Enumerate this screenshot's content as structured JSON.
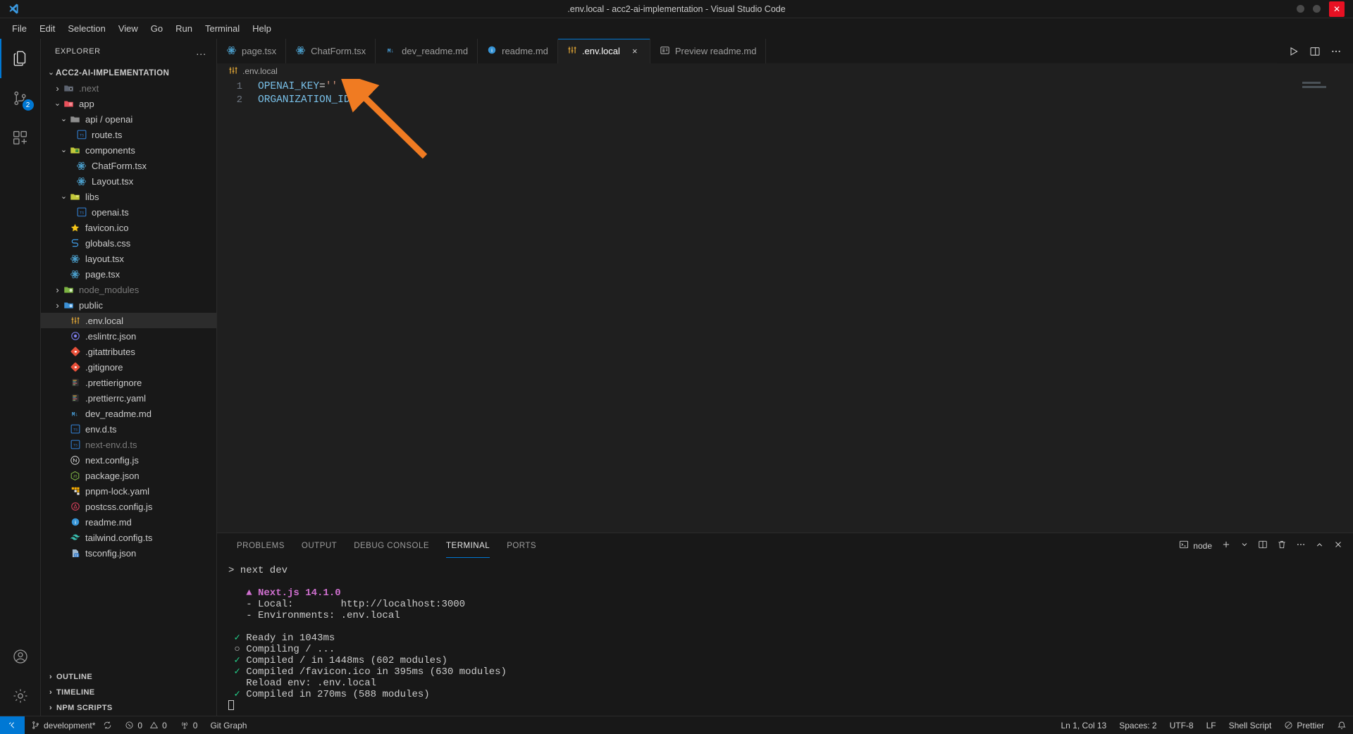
{
  "titlebar": {
    "title": ".env.local - acc2-ai-implementation - Visual Studio Code",
    "logo_icon": "vscode-logo-icon",
    "minimize_icon": "minimize-icon",
    "maximize_icon": "maximize-icon",
    "close_icon": "close-icon"
  },
  "menubar": {
    "items": [
      {
        "label": "File"
      },
      {
        "label": "Edit"
      },
      {
        "label": "Selection"
      },
      {
        "label": "View"
      },
      {
        "label": "Go"
      },
      {
        "label": "Run"
      },
      {
        "label": "Terminal"
      },
      {
        "label": "Help"
      }
    ]
  },
  "activitybar": {
    "items": [
      {
        "name": "explorer",
        "icon": "files-icon",
        "active": true,
        "badge": ""
      },
      {
        "name": "source-control",
        "icon": "source-control-icon",
        "active": false,
        "badge": "2"
      },
      {
        "name": "extensions",
        "icon": "extensions-icon",
        "active": false,
        "badge": ""
      }
    ],
    "bottom": [
      {
        "name": "accounts",
        "icon": "account-icon"
      },
      {
        "name": "settings",
        "icon": "gear-icon"
      }
    ]
  },
  "sidebar": {
    "title": "EXPLORER",
    "more_actions": "...",
    "root": "ACC2-AI-IMPLEMENTATION",
    "tree": [
      {
        "label": "ACC2-AI-IMPLEMENTATION",
        "indent": 0,
        "chevron": "down",
        "icon": "",
        "kind": "root"
      },
      {
        "label": ".next",
        "indent": 1,
        "chevron": "right",
        "icon": "folder-next",
        "kind": "folder",
        "dim": true
      },
      {
        "label": "app",
        "indent": 1,
        "chevron": "down",
        "icon": "folder-app",
        "kind": "folder"
      },
      {
        "label": "api / openai",
        "indent": 2,
        "chevron": "down",
        "icon": "folder-plain",
        "kind": "folder"
      },
      {
        "label": "route.ts",
        "indent": 3,
        "chevron": "none",
        "icon": "ts-icon",
        "kind": "file"
      },
      {
        "label": "components",
        "indent": 2,
        "chevron": "down",
        "icon": "folder-components",
        "kind": "folder"
      },
      {
        "label": "ChatForm.tsx",
        "indent": 3,
        "chevron": "none",
        "icon": "react-icon",
        "kind": "file"
      },
      {
        "label": "Layout.tsx",
        "indent": 3,
        "chevron": "none",
        "icon": "react-icon",
        "kind": "file"
      },
      {
        "label": "libs",
        "indent": 2,
        "chevron": "down",
        "icon": "folder-libs",
        "kind": "folder"
      },
      {
        "label": "openai.ts",
        "indent": 3,
        "chevron": "none",
        "icon": "ts-icon",
        "kind": "file"
      },
      {
        "label": "favicon.ico",
        "indent": 2,
        "chevron": "none",
        "icon": "star-icon",
        "kind": "file"
      },
      {
        "label": "globals.css",
        "indent": 2,
        "chevron": "none",
        "icon": "css-icon",
        "kind": "file"
      },
      {
        "label": "layout.tsx",
        "indent": 2,
        "chevron": "none",
        "icon": "react-icon",
        "kind": "file"
      },
      {
        "label": "page.tsx",
        "indent": 2,
        "chevron": "none",
        "icon": "react-icon",
        "kind": "file"
      },
      {
        "label": "node_modules",
        "indent": 1,
        "chevron": "right",
        "icon": "folder-node",
        "kind": "folder",
        "dim": true
      },
      {
        "label": "public",
        "indent": 1,
        "chevron": "right",
        "icon": "folder-public",
        "kind": "folder"
      },
      {
        "label": ".env.local",
        "indent": 2,
        "chevron": "none",
        "icon": "env-icon",
        "kind": "file",
        "selected": true
      },
      {
        "label": ".eslintrc.json",
        "indent": 2,
        "chevron": "none",
        "icon": "eslint-icon",
        "kind": "file"
      },
      {
        "label": ".gitattributes",
        "indent": 2,
        "chevron": "none",
        "icon": "git-icon",
        "kind": "file"
      },
      {
        "label": ".gitignore",
        "indent": 2,
        "chevron": "none",
        "icon": "git-icon",
        "kind": "file"
      },
      {
        "label": ".prettierignore",
        "indent": 2,
        "chevron": "none",
        "icon": "prettier-icon",
        "kind": "file"
      },
      {
        "label": ".prettierrc.yaml",
        "indent": 2,
        "chevron": "none",
        "icon": "prettier-icon",
        "kind": "file"
      },
      {
        "label": "dev_readme.md",
        "indent": 2,
        "chevron": "none",
        "icon": "markdown-icon",
        "kind": "file"
      },
      {
        "label": "env.d.ts",
        "indent": 2,
        "chevron": "none",
        "icon": "ts-icon",
        "kind": "file"
      },
      {
        "label": "next-env.d.ts",
        "indent": 2,
        "chevron": "none",
        "icon": "ts-icon",
        "kind": "file",
        "dim": true
      },
      {
        "label": "next.config.js",
        "indent": 2,
        "chevron": "none",
        "icon": "next-icon",
        "kind": "file"
      },
      {
        "label": "package.json",
        "indent": 2,
        "chevron": "none",
        "icon": "npm-icon",
        "kind": "file"
      },
      {
        "label": "pnpm-lock.yaml",
        "indent": 2,
        "chevron": "none",
        "icon": "pnpm-icon",
        "kind": "file"
      },
      {
        "label": "postcss.config.js",
        "indent": 2,
        "chevron": "none",
        "icon": "postcss-icon",
        "kind": "file"
      },
      {
        "label": "readme.md",
        "indent": 2,
        "chevron": "none",
        "icon": "info-icon",
        "kind": "file"
      },
      {
        "label": "tailwind.config.ts",
        "indent": 2,
        "chevron": "none",
        "icon": "tailwind-icon",
        "kind": "file"
      },
      {
        "label": "tsconfig.json",
        "indent": 2,
        "chevron": "none",
        "icon": "tsconfig-icon",
        "kind": "file"
      }
    ],
    "sections": [
      {
        "label": "OUTLINE",
        "chevron": "right"
      },
      {
        "label": "TIMELINE",
        "chevron": "right"
      },
      {
        "label": "NPM SCRIPTS",
        "chevron": "right"
      }
    ]
  },
  "editor": {
    "tabs": [
      {
        "label": "page.tsx",
        "icon": "react-icon",
        "active": false,
        "closable": false
      },
      {
        "label": "ChatForm.tsx",
        "icon": "react-icon",
        "active": false,
        "closable": false
      },
      {
        "label": "dev_readme.md",
        "icon": "markdown-icon",
        "active": false,
        "closable": false
      },
      {
        "label": "readme.md",
        "icon": "info-icon",
        "active": false,
        "closable": false
      },
      {
        "label": ".env.local",
        "icon": "env-icon",
        "active": true,
        "closable": true,
        "close_label": "×"
      },
      {
        "label": "Preview readme.md",
        "icon": "preview-icon",
        "active": false,
        "closable": false
      }
    ],
    "actions": [
      {
        "name": "run-button",
        "icon": "play-icon"
      },
      {
        "name": "split-editor-button",
        "icon": "split-editor-icon"
      },
      {
        "name": "more-actions-button",
        "icon": "ellipsis-icon"
      }
    ],
    "breadcrumb": {
      "icon": "env-icon",
      "label": ".env.local"
    },
    "lines": [
      {
        "number": "1",
        "tokens": [
          {
            "text": "OPENAI_KEY",
            "type": "var"
          },
          {
            "text": "=",
            "type": "op"
          },
          {
            "text": "''",
            "type": "str"
          }
        ]
      },
      {
        "number": "2",
        "tokens": [
          {
            "text": "ORGANIZATION_ID",
            "type": "var"
          },
          {
            "text": "=",
            "type": "op"
          },
          {
            "text": "''",
            "type": "str"
          }
        ]
      }
    ],
    "annotation": {
      "name": "orange-arrow-annotation",
      "color": "#f07b22"
    }
  },
  "panel": {
    "tabs": [
      {
        "label": "PROBLEMS",
        "active": false
      },
      {
        "label": "OUTPUT",
        "active": false
      },
      {
        "label": "DEBUG CONSOLE",
        "active": false
      },
      {
        "label": "TERMINAL",
        "active": true
      },
      {
        "label": "PORTS",
        "active": false
      }
    ],
    "terminal_chip": {
      "icon": "terminal-icon",
      "label": "node"
    },
    "actions": [
      {
        "name": "new-terminal-button",
        "icon": "plus-icon"
      },
      {
        "name": "terminal-dropdown-button",
        "icon": "chevron-down-icon"
      },
      {
        "name": "split-terminal-button",
        "icon": "split-icon"
      },
      {
        "name": "kill-terminal-button",
        "icon": "trash-icon"
      },
      {
        "name": "panel-more-button",
        "icon": "ellipsis-icon"
      },
      {
        "name": "maximize-panel-button",
        "icon": "chevron-up-icon"
      },
      {
        "name": "close-panel-button",
        "icon": "close-icon"
      }
    ],
    "terminal_lines": [
      {
        "segments": [
          {
            "text": "> next dev",
            "color": "grey"
          }
        ]
      },
      {
        "segments": [
          {
            "text": "",
            "color": "grey"
          }
        ]
      },
      {
        "segments": [
          {
            "text": "   ▲ Next.js 14.1.0",
            "color": "pink"
          }
        ]
      },
      {
        "segments": [
          {
            "text": "   - Local:        http://localhost:3000",
            "color": "grey"
          }
        ]
      },
      {
        "segments": [
          {
            "text": "   - Environments: .env.local",
            "color": "grey"
          }
        ]
      },
      {
        "segments": [
          {
            "text": "",
            "color": "grey"
          }
        ]
      },
      {
        "segments": [
          {
            "text": " ✓ ",
            "color": "green"
          },
          {
            "text": "Ready in 1043ms",
            "color": "grey"
          }
        ]
      },
      {
        "segments": [
          {
            "text": " ○ ",
            "color": "grey"
          },
          {
            "text": "Compiling / ...",
            "color": "grey"
          }
        ]
      },
      {
        "segments": [
          {
            "text": " ✓ ",
            "color": "green"
          },
          {
            "text": "Compiled / in 1448ms (602 modules)",
            "color": "grey"
          }
        ]
      },
      {
        "segments": [
          {
            "text": " ✓ ",
            "color": "green"
          },
          {
            "text": "Compiled /favicon.ico in 395ms (630 modules)",
            "color": "grey"
          }
        ]
      },
      {
        "segments": [
          {
            "text": "   Reload env: .env.local",
            "color": "grey"
          }
        ]
      },
      {
        "segments": [
          {
            "text": " ✓ ",
            "color": "green"
          },
          {
            "text": "Compiled in 270ms (588 modules)",
            "color": "grey"
          }
        ]
      }
    ]
  },
  "statusbar": {
    "remote_icon": "remote-window-icon",
    "left": [
      {
        "name": "branch",
        "icon": "source-control-icon",
        "label": "development*"
      },
      {
        "name": "sync",
        "icon": "sync-icon",
        "label": ""
      },
      {
        "name": "errors",
        "icon": "error-icon",
        "label": "0"
      },
      {
        "name": "warnings",
        "icon": "warning-icon",
        "label": "0"
      },
      {
        "name": "ports",
        "icon": "radio-tower-icon",
        "label": "0"
      },
      {
        "name": "git-graph",
        "icon": "",
        "label": "Git Graph"
      }
    ],
    "right": [
      {
        "name": "cursor-position",
        "label": "Ln 1, Col 13"
      },
      {
        "name": "indentation",
        "label": "Spaces: 2"
      },
      {
        "name": "encoding",
        "label": "UTF-8"
      },
      {
        "name": "eol",
        "label": "LF"
      },
      {
        "name": "language-mode",
        "label": "Shell Script"
      },
      {
        "name": "prettier",
        "icon": "prettier-status-icon",
        "label": "Prettier"
      },
      {
        "name": "notifications",
        "icon": "bell-icon",
        "label": ""
      }
    ]
  }
}
